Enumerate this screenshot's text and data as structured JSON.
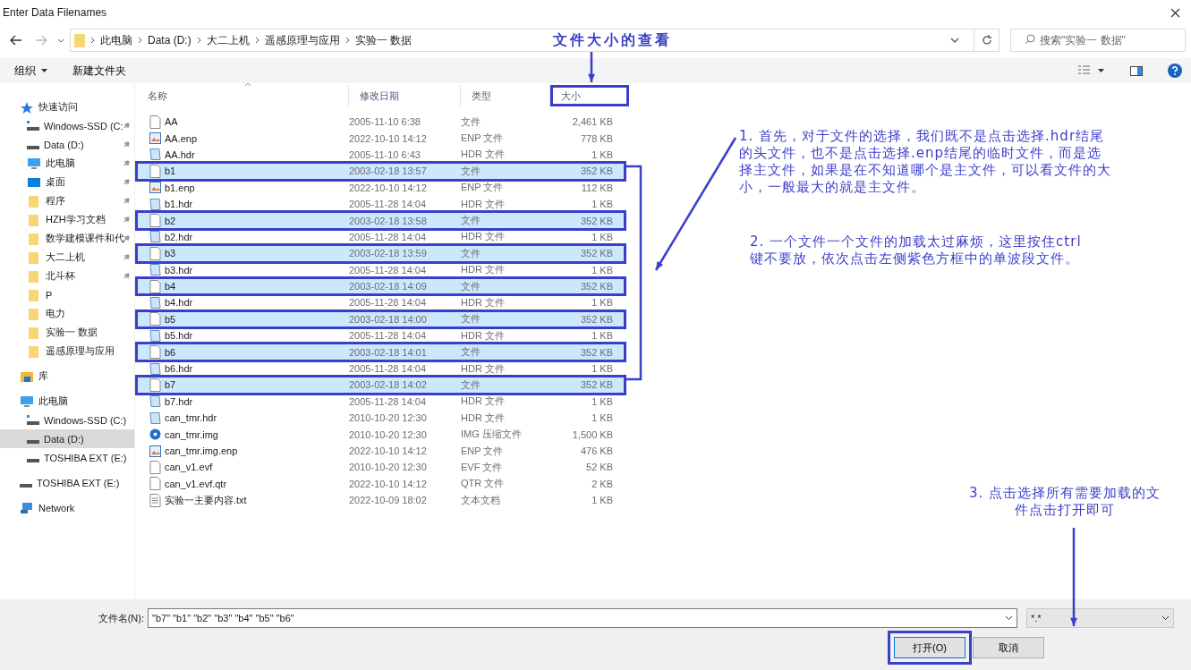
{
  "window": {
    "title": "Enter Data Filenames"
  },
  "address_bar": {
    "path": [
      "此电脑",
      "Data (D:)",
      "大二上机",
      "遥感原理与应用",
      "实验一 数据"
    ],
    "search_placeholder": "搜索\"实验一 数据\""
  },
  "toolbar": {
    "buttons": [
      "组织",
      "新建文件夹"
    ]
  },
  "sidebar": {
    "items": [
      {
        "label": "快速访问",
        "kind": "star",
        "selected": false,
        "children": [
          {
            "label": "Windows-SSD (C:",
            "kind": "windrive",
            "pinned": true,
            "selected": false
          },
          {
            "label": "Data (D:)",
            "kind": "drive",
            "pinned": true,
            "selected": false
          },
          {
            "label": "此电脑",
            "kind": "computer",
            "pinned": true,
            "selected": false
          },
          {
            "label": "桌面",
            "kind": "desktop",
            "pinned": true,
            "selected": false
          },
          {
            "label": "程序",
            "kind": "folder",
            "pinned": true,
            "selected": false
          },
          {
            "label": "HZH学习文档",
            "kind": "folder",
            "pinned": true,
            "selected": false
          },
          {
            "label": "数学建模课件和代",
            "kind": "folder",
            "pinned": true,
            "selected": false
          },
          {
            "label": "大二上机",
            "kind": "folder",
            "pinned": true,
            "selected": false
          },
          {
            "label": "北斗杯",
            "kind": "folder",
            "pinned": true,
            "selected": false
          },
          {
            "label": "P",
            "kind": "folder",
            "pinned": false,
            "selected": false
          },
          {
            "label": "电力",
            "kind": "folder",
            "pinned": false,
            "selected": false
          },
          {
            "label": "实验一 数据",
            "kind": "folder",
            "pinned": false,
            "selected": false
          },
          {
            "label": "遥感原理与应用",
            "kind": "folder",
            "pinned": false,
            "selected": false
          }
        ]
      },
      {
        "label": "库",
        "kind": "library",
        "selected": false
      },
      {
        "label": "此电脑",
        "kind": "computer",
        "selected": false,
        "children": [
          {
            "label": "Windows-SSD (C:)",
            "kind": "windrive",
            "pinned": false,
            "selected": false
          },
          {
            "label": "Data (D:)",
            "kind": "drive",
            "pinned": false,
            "selected": true
          },
          {
            "label": "TOSHIBA EXT (E:)",
            "kind": "drive",
            "pinned": false,
            "selected": false
          }
        ]
      },
      {
        "label": "TOSHIBA EXT (E:)",
        "kind": "drive",
        "selected": false
      },
      {
        "label": "Network",
        "kind": "network",
        "selected": false
      }
    ]
  },
  "file_list": {
    "columns": [
      {
        "label": "名称",
        "highlighted": false
      },
      {
        "label": "修改日期",
        "highlighted": false
      },
      {
        "label": "类型",
        "highlighted": false
      },
      {
        "label": "大小",
        "highlighted": true
      }
    ],
    "rows": [
      {
        "name": "AA",
        "date": "2005-11-10 6:38",
        "type": "文件",
        "size": "2,461 KB",
        "kind": "blank",
        "selected": false
      },
      {
        "name": "AA.enp",
        "date": "2022-10-10 14:12",
        "type": "ENP 文件",
        "size": "778 KB",
        "kind": "enp",
        "selected": false
      },
      {
        "name": "AA.hdr",
        "date": "2005-11-10 6:43",
        "type": "HDR 文件",
        "size": "1 KB",
        "kind": "hdr",
        "selected": false
      },
      {
        "name": "b1",
        "date": "2003-02-18 13:57",
        "type": "文件",
        "size": "352 KB",
        "kind": "blank",
        "selected": true
      },
      {
        "name": "b1.enp",
        "date": "2022-10-10 14:12",
        "type": "ENP 文件",
        "size": "112 KB",
        "kind": "enp",
        "selected": false
      },
      {
        "name": "b1.hdr",
        "date": "2005-11-28 14:04",
        "type": "HDR 文件",
        "size": "1 KB",
        "kind": "hdr",
        "selected": false
      },
      {
        "name": "b2",
        "date": "2003-02-18 13:58",
        "type": "文件",
        "size": "352 KB",
        "kind": "blank",
        "selected": true
      },
      {
        "name": "b2.hdr",
        "date": "2005-11-28 14:04",
        "type": "HDR 文件",
        "size": "1 KB",
        "kind": "hdr",
        "selected": false
      },
      {
        "name": "b3",
        "date": "2003-02-18 13:59",
        "type": "文件",
        "size": "352 KB",
        "kind": "blank",
        "selected": true
      },
      {
        "name": "b3.hdr",
        "date": "2005-11-28 14:04",
        "type": "HDR 文件",
        "size": "1 KB",
        "kind": "hdr",
        "selected": false
      },
      {
        "name": "b4",
        "date": "2003-02-18 14:09",
        "type": "文件",
        "size": "352 KB",
        "kind": "blank",
        "selected": true
      },
      {
        "name": "b4.hdr",
        "date": "2005-11-28 14:04",
        "type": "HDR 文件",
        "size": "1 KB",
        "kind": "hdr",
        "selected": false
      },
      {
        "name": "b5",
        "date": "2003-02-18 14:00",
        "type": "文件",
        "size": "352 KB",
        "kind": "blank",
        "selected": true
      },
      {
        "name": "b5.hdr",
        "date": "2005-11-28 14:04",
        "type": "HDR 文件",
        "size": "1 KB",
        "kind": "hdr",
        "selected": false
      },
      {
        "name": "b6",
        "date": "2003-02-18 14:01",
        "type": "文件",
        "size": "352 KB",
        "kind": "blank",
        "selected": true
      },
      {
        "name": "b6.hdr",
        "date": "2005-11-28 14:04",
        "type": "HDR 文件",
        "size": "1 KB",
        "kind": "hdr",
        "selected": false
      },
      {
        "name": "b7",
        "date": "2003-02-18 14:02",
        "type": "文件",
        "size": "352 KB",
        "kind": "blank",
        "selected": true
      },
      {
        "name": "b7.hdr",
        "date": "2005-11-28 14:04",
        "type": "HDR 文件",
        "size": "1 KB",
        "kind": "hdr",
        "selected": false
      },
      {
        "name": "can_tmr.hdr",
        "date": "2010-10-20 12:30",
        "type": "HDR 文件",
        "size": "1 KB",
        "kind": "hdr",
        "selected": false
      },
      {
        "name": "can_tmr.img",
        "date": "2010-10-20 12:30",
        "type": "IMG 压缩文件",
        "size": "1,500 KB",
        "kind": "img",
        "selected": false
      },
      {
        "name": "can_tmr.img.enp",
        "date": "2022-10-10 14:12",
        "type": "ENP 文件",
        "size": "476 KB",
        "kind": "enp",
        "selected": false
      },
      {
        "name": "can_v1.evf",
        "date": "2010-10-20 12:30",
        "type": "EVF 文件",
        "size": "52 KB",
        "kind": "blank",
        "selected": false
      },
      {
        "name": "can_v1.evf.qtr",
        "date": "2022-10-10 14:12",
        "type": "QTR 文件",
        "size": "2 KB",
        "kind": "blank",
        "selected": false
      },
      {
        "name": "实验一主要内容.txt",
        "date": "2022-10-09 18:02",
        "type": "文本文档",
        "size": "1 KB",
        "kind": "txt",
        "selected": false
      }
    ]
  },
  "annotations": {
    "heading": "文件大小的查看",
    "notes": [
      "1. 首先，对于文件的选择，我们既不是点击选择.hdr结尾的头文件，也不是点击选择.enp结尾的临时文件，而是选择主文件，如果是在不知道哪个是主文件，可以看文件的大小，一般最大的就是主文件。",
      "2. 一个文件一个文件的加载太过麻烦，这里按住ctrl键不要放，依次点击左侧紫色方框中的单波段文件。",
      "3. 点击选择所有需要加载的文件点击打开即可"
    ]
  },
  "footer": {
    "filename_label": "文件名(N):",
    "filename_value": "\"b7\" \"b1\" \"b2\" \"b3\" \"b4\" \"b5\" \"b6\"",
    "filter": "*.*",
    "buttons": [
      {
        "label": "打开(O)",
        "highlighted": true
      },
      {
        "label": "取消",
        "highlighted": false
      }
    ]
  }
}
